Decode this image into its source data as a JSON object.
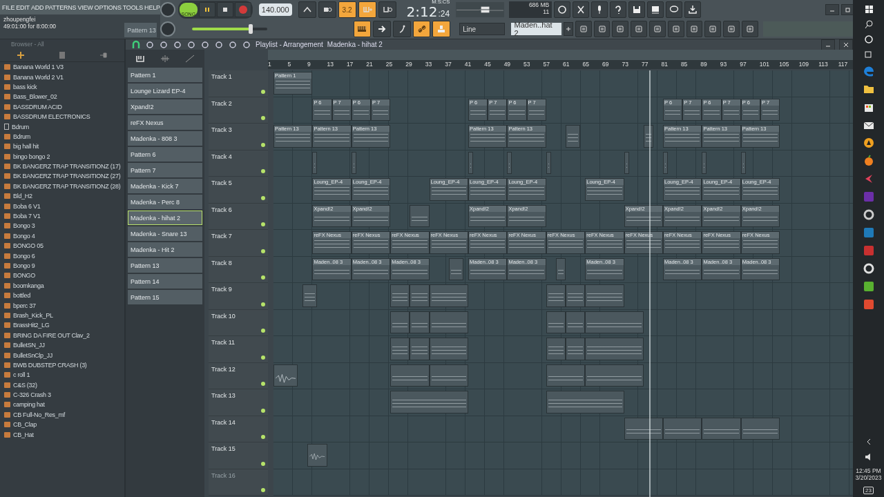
{
  "menu": [
    "FILE",
    "EDIT",
    "ADD",
    "PATTERNS",
    "VIEW",
    "OPTIONS",
    "TOOLS",
    "HELP"
  ],
  "hint": {
    "user": "zhoupengfei",
    "position": "49:01:00 for 8:00:00",
    "pattern": "Pattern 13"
  },
  "transport": {
    "mode_label": "SONG",
    "song_mode": true,
    "playing": false,
    "tempo": "140.000",
    "time": "2:12",
    "time_small": ":24",
    "time_unit": "M:S:CS",
    "memory": "686 MB",
    "cpu": "11"
  },
  "master_volume": {
    "level": 0.78
  },
  "toggles_top": [
    {
      "kind": "wait",
      "on": false
    },
    {
      "kind": "record",
      "on": false
    },
    {
      "kind": "countdown",
      "label": "3.2",
      "on": true
    },
    {
      "kind": "step",
      "on": true
    },
    {
      "kind": "loop",
      "on": false
    }
  ],
  "toggles_bottom": [
    {
      "kind": "keyboard",
      "on": true
    },
    {
      "kind": "arrow",
      "on": false
    },
    {
      "kind": "snap",
      "on": false
    },
    {
      "kind": "link",
      "on": true
    },
    {
      "kind": "stamp",
      "on": true
    }
  ],
  "snap": "Line",
  "current_pattern": "Maden..hat 2",
  "browser": {
    "title": "Browser - All",
    "items": [
      {
        "name": "Banana World 1 V3",
        "kind": "folder"
      },
      {
        "name": "Banana World 2 V1",
        "kind": "folder"
      },
      {
        "name": "bass kick",
        "kind": "folder"
      },
      {
        "name": "Bass_Blower_02",
        "kind": "folder"
      },
      {
        "name": "BASSDRUM ACID",
        "kind": "folder"
      },
      {
        "name": "BASSDRUM ELECTRONICS",
        "kind": "folder"
      },
      {
        "name": "Bdrum",
        "kind": "file"
      },
      {
        "name": "Bdrum",
        "kind": "folder"
      },
      {
        "name": "big hall hit",
        "kind": "folder"
      },
      {
        "name": "bingo bongo 2",
        "kind": "folder"
      },
      {
        "name": "BK BANGERZ TRAP TRANSITIONZ (17)",
        "kind": "folder"
      },
      {
        "name": "BK BANGERZ TRAP TRANSITIONZ (27)",
        "kind": "folder"
      },
      {
        "name": "BK BANGERZ TRAP TRANSITIONZ (28)",
        "kind": "folder"
      },
      {
        "name": "Bld_H2",
        "kind": "folder"
      },
      {
        "name": "Boba 6 V1",
        "kind": "folder"
      },
      {
        "name": "Boba 7 V1",
        "kind": "folder"
      },
      {
        "name": "Bongo 3",
        "kind": "folder"
      },
      {
        "name": "Bongo 4",
        "kind": "folder"
      },
      {
        "name": "BONGO 05",
        "kind": "folder"
      },
      {
        "name": "Bongo 6",
        "kind": "folder"
      },
      {
        "name": "Bongo 9",
        "kind": "folder"
      },
      {
        "name": "BONGO",
        "kind": "folder"
      },
      {
        "name": "boomkanga",
        "kind": "folder"
      },
      {
        "name": "bottled",
        "kind": "folder"
      },
      {
        "name": "bperc 37",
        "kind": "folder"
      },
      {
        "name": "Brash_Kick_PL",
        "kind": "folder"
      },
      {
        "name": "BrassHit2_LG",
        "kind": "folder"
      },
      {
        "name": "BRING DA FIRE OUT Clav_2",
        "kind": "folder"
      },
      {
        "name": "BulletSN_JJ",
        "kind": "folder"
      },
      {
        "name": "BulletSnClp_JJ",
        "kind": "folder"
      },
      {
        "name": "BWB DUBSTEP CRASH (3)",
        "kind": "folder"
      },
      {
        "name": "c roll 1",
        "kind": "folder"
      },
      {
        "name": "C&S (32)",
        "kind": "folder"
      },
      {
        "name": "C-326 Crash 3",
        "kind": "folder"
      },
      {
        "name": "camping hat",
        "kind": "folder"
      },
      {
        "name": "CB Full-No_Res_mf",
        "kind": "folder"
      },
      {
        "name": "CB_Clap",
        "kind": "folder"
      },
      {
        "name": "CB_Hat",
        "kind": "folder"
      }
    ]
  },
  "patterns": [
    {
      "name": "Pattern 1",
      "selected": false
    },
    {
      "name": "Lounge Lizard EP-4",
      "selected": false
    },
    {
      "name": "Xpand!2",
      "selected": false
    },
    {
      "name": "reFX Nexus",
      "selected": false
    },
    {
      "name": "Madenka - 808 3",
      "selected": false
    },
    {
      "name": "Pattern 6",
      "selected": false
    },
    {
      "name": "Pattern 7",
      "selected": false
    },
    {
      "name": "Madenka - Kick 7",
      "selected": false
    },
    {
      "name": "Madenka - Perc 8",
      "selected": false
    },
    {
      "name": "Madenka - hihat 2",
      "selected": true
    },
    {
      "name": "Madenka - Snare 13",
      "selected": false
    },
    {
      "name": "Madenka - Hit 2",
      "selected": false
    },
    {
      "name": "Pattern 13",
      "selected": false
    },
    {
      "name": "Pattern 14",
      "selected": false
    },
    {
      "name": "Pattern 15",
      "selected": false
    }
  ],
  "playlist": {
    "title": "Playlist - Arrangement",
    "pattern": "Madenka - hihat 2",
    "ruler": [
      "1",
      "5",
      "9",
      "13",
      "17",
      "21",
      "25",
      "29",
      "33",
      "37",
      "41",
      "45",
      "49",
      "53",
      "57",
      "61",
      "65",
      "69",
      "73",
      "77",
      "81",
      "85",
      "89",
      "93",
      "97",
      "101",
      "105",
      "109",
      "113",
      "117"
    ],
    "playhead": {
      "level": 0.652
    },
    "tracks": [
      {
        "name": "Track 1",
        "clips": [
          {
            "kind": "pattern",
            "label": "Pattern 1"
          }
        ]
      },
      {
        "name": "Track 2",
        "clips": [
          {
            "kind": "pattern",
            "label": "P 6"
          },
          {
            "kind": "pattern",
            "label": "P 7"
          },
          {
            "kind": "pattern",
            "label": "P 6"
          },
          {
            "kind": "pattern",
            "label": "P 7"
          },
          {
            "kind": "pattern",
            "label": "P 6"
          },
          {
            "kind": "pattern",
            "label": "P 7"
          },
          {
            "kind": "pattern",
            "label": "P 6"
          },
          {
            "kind": "pattern",
            "label": "P 7"
          },
          {
            "kind": "pattern",
            "label": "P 6"
          },
          {
            "kind": "pattern",
            "label": "P 7"
          },
          {
            "kind": "pattern",
            "label": "P 6"
          },
          {
            "kind": "pattern",
            "label": "P 7"
          },
          {
            "kind": "pattern",
            "label": "P 6"
          },
          {
            "kind": "pattern",
            "label": "P 7"
          }
        ]
      },
      {
        "name": "Track 3",
        "clips": [
          {
            "kind": "pattern",
            "label": "Pattern 13"
          },
          {
            "kind": "pattern",
            "label": "Pattern 13"
          },
          {
            "kind": "pattern",
            "label": "Pattern 13"
          },
          {
            "kind": "pattern",
            "label": "Pattern 13"
          },
          {
            "kind": "pattern",
            "label": "Pattern 13"
          },
          {
            "kind": "pattern"
          },
          {
            "kind": "pattern"
          },
          {
            "kind": "pattern",
            "label": "Pattern 13"
          },
          {
            "kind": "pattern",
            "label": "Pattern 13"
          },
          {
            "kind": "pattern",
            "label": "Pattern 13"
          }
        ]
      },
      {
        "name": "Track 4",
        "clips": [
          {
            "kind": "pattern"
          },
          {
            "kind": "pattern"
          },
          {
            "kind": "pattern"
          },
          {
            "kind": "pattern"
          },
          {
            "kind": "pattern"
          },
          {
            "kind": "pattern"
          },
          {
            "kind": "pattern"
          },
          {
            "kind": "pattern"
          },
          {
            "kind": "pattern"
          }
        ]
      },
      {
        "name": "Track 5",
        "clips": [
          {
            "kind": "pattern",
            "label": "Loung_EP-4"
          },
          {
            "kind": "pattern",
            "label": "Loung_EP-4"
          },
          {
            "kind": "pattern",
            "label": "Loung_EP-4"
          },
          {
            "kind": "pattern",
            "label": "Loung_EP-4"
          },
          {
            "kind": "pattern",
            "label": "Loung_EP-4"
          },
          {
            "kind": "pattern",
            "label": "Loung_EP-4"
          },
          {
            "kind": "pattern",
            "label": "Loung_EP-4"
          },
          {
            "kind": "pattern",
            "label": "Loung_EP-4"
          },
          {
            "kind": "pattern",
            "label": "Loung_EP-4"
          }
        ]
      },
      {
        "name": "Track 6",
        "clips": [
          {
            "kind": "pattern",
            "label": "Xpand!2"
          },
          {
            "kind": "pattern",
            "label": "Xpand!2"
          },
          {
            "kind": "pattern"
          },
          {
            "kind": "pattern",
            "label": "Xpand!2"
          },
          {
            "kind": "pattern",
            "label": "Xpand!2"
          },
          {
            "kind": "pattern",
            "label": "Xpand!2"
          },
          {
            "kind": "pattern",
            "label": "Xpand!2"
          },
          {
            "kind": "pattern",
            "label": "Xpand!2"
          },
          {
            "kind": "pattern",
            "label": "Xpand!2"
          }
        ]
      },
      {
        "name": "Track 7",
        "clips": [
          {
            "kind": "pattern",
            "label": "reFX Nexus"
          },
          {
            "kind": "pattern",
            "label": "reFX Nexus"
          },
          {
            "kind": "pattern",
            "label": "reFX Nexus"
          },
          {
            "kind": "pattern",
            "label": "reFX Nexus"
          },
          {
            "kind": "pattern",
            "label": "reFX Nexus"
          },
          {
            "kind": "pattern",
            "label": "reFX Nexus"
          },
          {
            "kind": "pattern",
            "label": "reFX Nexus"
          },
          {
            "kind": "pattern",
            "label": "reFX Nexus"
          },
          {
            "kind": "pattern",
            "label": "reFX Nexus"
          },
          {
            "kind": "pattern",
            "label": "reFX Nexus"
          },
          {
            "kind": "pattern",
            "label": "reFX Nexus"
          },
          {
            "kind": "pattern",
            "label": "reFX Nexus"
          }
        ]
      },
      {
        "name": "Track 8",
        "clips": [
          {
            "kind": "pattern",
            "label": "Maden..08 3"
          },
          {
            "kind": "pattern",
            "label": "Maden..08 3"
          },
          {
            "kind": "pattern",
            "label": "Maden..08 3"
          },
          {
            "kind": "pattern"
          },
          {
            "kind": "pattern",
            "label": "Maden..08 3"
          },
          {
            "kind": "pattern",
            "label": "Maden..08 3"
          },
          {
            "kind": "pattern"
          },
          {
            "kind": "pattern",
            "label": "Maden..08 3"
          },
          {
            "kind": "pattern",
            "label": "Maden..08 3"
          },
          {
            "kind": "pattern",
            "label": "Maden..08 3"
          },
          {
            "kind": "pattern",
            "label": "Maden..08 3"
          }
        ]
      },
      {
        "name": "Track 9",
        "clips": [
          {
            "kind": "pattern"
          },
          {
            "kind": "pattern"
          },
          {
            "kind": "pattern"
          },
          {
            "kind": "pattern"
          },
          {
            "kind": "pattern"
          },
          {
            "kind": "pattern"
          },
          {
            "kind": "pattern"
          }
        ]
      },
      {
        "name": "Track 10",
        "clips": [
          {
            "kind": "pattern"
          },
          {
            "kind": "pattern"
          },
          {
            "kind": "pattern"
          },
          {
            "kind": "pattern"
          },
          {
            "kind": "pattern"
          },
          {
            "kind": "pattern"
          }
        ]
      },
      {
        "name": "Track 11",
        "clips": [
          {
            "kind": "pattern"
          },
          {
            "kind": "pattern"
          },
          {
            "kind": "pattern"
          },
          {
            "kind": "pattern"
          },
          {
            "kind": "pattern"
          },
          {
            "kind": "pattern"
          }
        ]
      },
      {
        "name": "Track 12",
        "clips": [
          {
            "kind": "audio"
          },
          {
            "kind": "pattern"
          },
          {
            "kind": "pattern"
          },
          {
            "kind": "pattern"
          },
          {
            "kind": "pattern"
          }
        ]
      },
      {
        "name": "Track 13",
        "clips": [
          {
            "kind": "pattern"
          },
          {
            "kind": "pattern"
          }
        ]
      },
      {
        "name": "Track 14",
        "clips": [
          {
            "kind": "pattern"
          },
          {
            "kind": "pattern"
          },
          {
            "kind": "pattern"
          },
          {
            "kind": "pattern"
          }
        ]
      },
      {
        "name": "Track 15",
        "clips": [
          {
            "kind": "audio"
          }
        ]
      },
      {
        "name": "Track 16"
      }
    ]
  },
  "taskbar": {
    "time": "12:45 PM",
    "date": "3/20/2023",
    "notifications": "23",
    "apps": [
      {
        "kind": "edge",
        "color": "#1e7fd8"
      },
      {
        "kind": "folder",
        "color": "#f0c040"
      },
      {
        "kind": "store",
        "color": "#e8e8e8"
      },
      {
        "kind": "mail",
        "color": "#e8e8e8"
      },
      {
        "kind": "circle",
        "color": "#f0a020"
      },
      {
        "kind": "fruit",
        "color": "#f08020"
      },
      {
        "kind": "arrow",
        "color": "#e0405a"
      },
      {
        "kind": "square",
        "color": "#6b2fa8"
      },
      {
        "kind": "ring",
        "color": "#cccccc"
      },
      {
        "kind": "square",
        "color": "#1f7ab8"
      },
      {
        "kind": "square",
        "color": "#c83030"
      },
      {
        "kind": "ring",
        "color": "#e0e0e0"
      },
      {
        "kind": "square",
        "color": "#59b030"
      },
      {
        "kind": "square",
        "color": "#e04a30"
      }
    ]
  }
}
